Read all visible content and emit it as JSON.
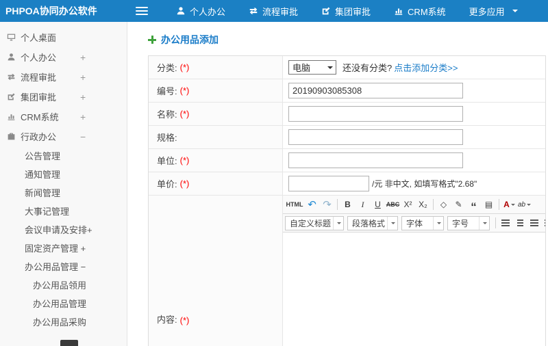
{
  "topbar": {
    "brand": "PHPOA协同办公软件",
    "nav": [
      {
        "label": "个人办公"
      },
      {
        "label": "流程审批"
      },
      {
        "label": "集团审批"
      },
      {
        "label": "CRM系统"
      },
      {
        "label": "更多应用"
      }
    ]
  },
  "sidebar": {
    "items": [
      {
        "label": "个人桌面",
        "expander": ""
      },
      {
        "label": "个人办公",
        "expander": "+"
      },
      {
        "label": "流程审批",
        "expander": "+"
      },
      {
        "label": "集团审批",
        "expander": "+"
      },
      {
        "label": "CRM系统",
        "expander": "+"
      },
      {
        "label": "行政办公",
        "expander": "−"
      }
    ],
    "admin_sub": [
      {
        "label": "公告管理"
      },
      {
        "label": "通知管理"
      },
      {
        "label": "新闻管理"
      },
      {
        "label": "大事记管理"
      },
      {
        "label": "会议申请及安排+"
      },
      {
        "label": "固定资产管理 +"
      },
      {
        "label": "办公用品管理 −"
      }
    ],
    "supplies_sub": [
      {
        "label": "办公用品领用"
      },
      {
        "label": "办公用品管理"
      },
      {
        "label": "办公用品采购"
      }
    ]
  },
  "page": {
    "title": "办公用品添加"
  },
  "form": {
    "required": "(*)",
    "rows": {
      "category": {
        "label": "分类:",
        "selected": "电脑",
        "hint": "还没有分类?",
        "link": "点击添加分类>>"
      },
      "code": {
        "label": "编号:",
        "value": "20190903085308"
      },
      "name": {
        "label": "名称:"
      },
      "spec": {
        "label": "规格:"
      },
      "unit": {
        "label": "单位:"
      },
      "price": {
        "label": "单价:",
        "suffix": "/元 非中文, 如填写格式\"2.68\""
      },
      "content": {
        "label": "内容:"
      }
    }
  },
  "editor": {
    "buttons": {
      "html": "HTML",
      "undo": "↶",
      "redo": "↷",
      "bold": "B",
      "italic": "I",
      "underline": "U",
      "strike": "ABC",
      "sup": "X²",
      "sub": "X₂",
      "removeformat": "◇",
      "formatpainter": "✎",
      "blockquote": "“",
      "pagebreak": "▤",
      "forecolor": "A",
      "backcolor": "ab"
    },
    "dropdowns": {
      "heading": "自定义标题",
      "paragraph": "段落格式",
      "font": "字体",
      "size": "字号"
    }
  }
}
